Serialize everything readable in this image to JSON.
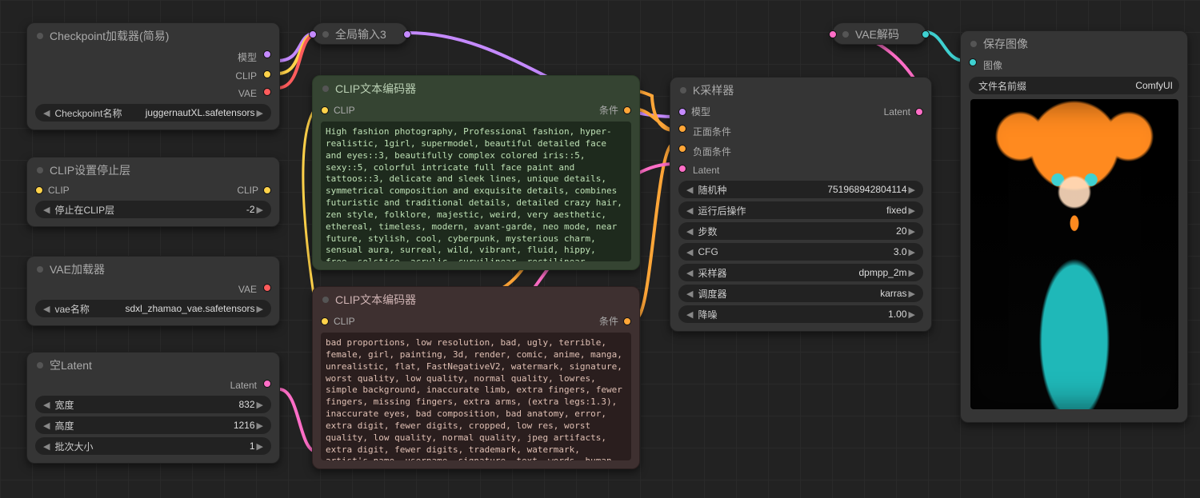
{
  "checkpoint": {
    "title": "Checkpoint加载器(简易)",
    "out_model": "模型",
    "out_clip": "CLIP",
    "out_vae": "VAE",
    "widget_label": "Checkpoint名称",
    "widget_value": "juggernautXL.safetensors"
  },
  "clip_stop": {
    "title": "CLIP设置停止层",
    "in_clip": "CLIP",
    "out_clip": "CLIP",
    "widget_label": "停止在CLIP层",
    "widget_value": "-2"
  },
  "vae_loader": {
    "title": "VAE加载器",
    "out_vae": "VAE",
    "widget_label": "vae名称",
    "widget_value": "sdxl_zhamao_vae.safetensors"
  },
  "empty_latent": {
    "title": "空Latent",
    "out_latent": "Latent",
    "width_label": "宽度",
    "width_value": "832",
    "height_label": "高度",
    "height_value": "1216",
    "batch_label": "批次大小",
    "batch_value": "1"
  },
  "global_in": {
    "title": "全局输入3"
  },
  "clip_pos": {
    "title": "CLIP文本编码器",
    "in_clip": "CLIP",
    "out_cond": "条件",
    "text": "High fashion photography, Professional fashion, hyper-realistic, 1girl, supermodel, beautiful detailed face and eyes::3, beautifully complex colored iris::5, sexy::5, colorful intricate full face paint and tattoos::3, delicate and sleek lines, unique details, symmetrical composition and exquisite details, combines futuristic and traditional details, detailed crazy hair, zen style, folklore, majestic, weird, very aesthetic, ethereal, timeless, modern, avant-garde, neo mode, near future, stylish, cool, cyberpunk, mysterious charm, sensual aura, surreal, wild, vibrant, fluid, hippy, free, solstice, acrylic, curvilinear, rectilinear, digital material, innovative materials, natural elements, Naturalism Fusion, these fashion forms are rich in symbolism"
  },
  "clip_neg": {
    "title": "CLIP文本编码器",
    "in_clip": "CLIP",
    "out_cond": "条件",
    "text": "bad proportions, low resolution, bad, ugly, terrible, female, girl, painting, 3d, render, comic, anime, manga, unrealistic, flat, FastNegativeV2, watermark, signature, worst quality, low quality, normal quality, lowres, simple background, inaccurate limb, extra fingers, fewer fingers, missing fingers, extra arms, (extra legs:1.3), inaccurate eyes, bad composition, bad anatomy, error, extra digit, fewer digits, cropped, low res, worst quality, low quality, normal quality, jpeg artifacts, extra digit, fewer digits, trademark, watermark, artist's name, username, signature, text, words, human, american flag, muscular"
  },
  "ksampler": {
    "title": "K采样器",
    "in_model": "模型",
    "in_pos": "正面条件",
    "in_neg": "负面条件",
    "in_latent": "Latent",
    "out_latent": "Latent",
    "seed_label": "随机种",
    "seed_value": "751968942804114",
    "after_label": "运行后操作",
    "after_value": "fixed",
    "steps_label": "步数",
    "steps_value": "20",
    "cfg_label": "CFG",
    "cfg_value": "3.0",
    "sampler_label": "采样器",
    "sampler_value": "dpmpp_2m",
    "scheduler_label": "调度器",
    "scheduler_value": "karras",
    "denoise_label": "降噪",
    "denoise_value": "1.00"
  },
  "vae_decode": {
    "title": "VAE解码"
  },
  "save_image": {
    "title": "保存图像",
    "in_images": "图像",
    "prefix_label": "文件名前缀",
    "prefix_value": "ComfyUI"
  }
}
